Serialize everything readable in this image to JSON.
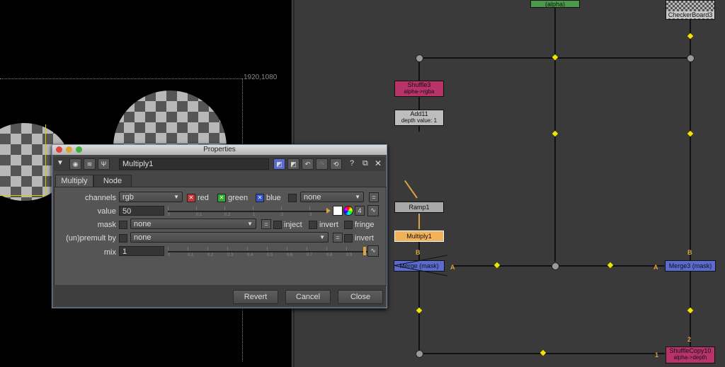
{
  "viewer": {
    "format_label": "1920,1080"
  },
  "graph": {
    "nodes": {
      "top_green": {
        "label": "(alpha)"
      },
      "checkerboard": {
        "label": "CheckerBoard3"
      },
      "shuffle3": {
        "label": "Shuffle3",
        "sub": "alpha->rgba"
      },
      "add11": {
        "label": "Add11",
        "sub": "depth value: 1"
      },
      "ramp1": {
        "label": "Ramp1"
      },
      "multiply1": {
        "label": "Multiply1"
      },
      "merge_left": {
        "label": "Merge (mask)"
      },
      "merge3": {
        "label": "Merge3 (mask)"
      },
      "shufflecopy10": {
        "label": "ShuffleCopy10",
        "sub": "alpha->depth"
      }
    },
    "input_labels": {
      "b_left": "B",
      "a_left": "A",
      "a_right": "A",
      "b_right": "B",
      "two": "2",
      "one": "1"
    }
  },
  "props": {
    "title": "Properties",
    "node_name": "Multiply1",
    "tabs": [
      "Multiply",
      "Node"
    ],
    "help_icon": "?",
    "channels": {
      "label": "channels",
      "value": "rgb",
      "red": "red",
      "green": "green",
      "blue": "blue",
      "extra": "none"
    },
    "value": {
      "label": "value",
      "number": "50",
      "count": "4",
      "ticks": [
        "0",
        "0.1",
        "0.2",
        "1",
        "2",
        "3",
        "4",
        "5"
      ]
    },
    "mask": {
      "label": "mask",
      "value": "none",
      "inject": "inject",
      "invert": "invert",
      "fringe": "fringe"
    },
    "premult": {
      "label": "(un)premult by",
      "value": "none",
      "invert": "invert"
    },
    "mix": {
      "label": "mix",
      "value": "1",
      "ticks": [
        "0",
        "0.1",
        "0.2",
        "0.3",
        "0.4",
        "0.5",
        "0.6",
        "0.7",
        "0.8",
        "0.9"
      ]
    },
    "buttons": {
      "revert": "Revert",
      "cancel": "Cancel",
      "close": "Close"
    }
  }
}
